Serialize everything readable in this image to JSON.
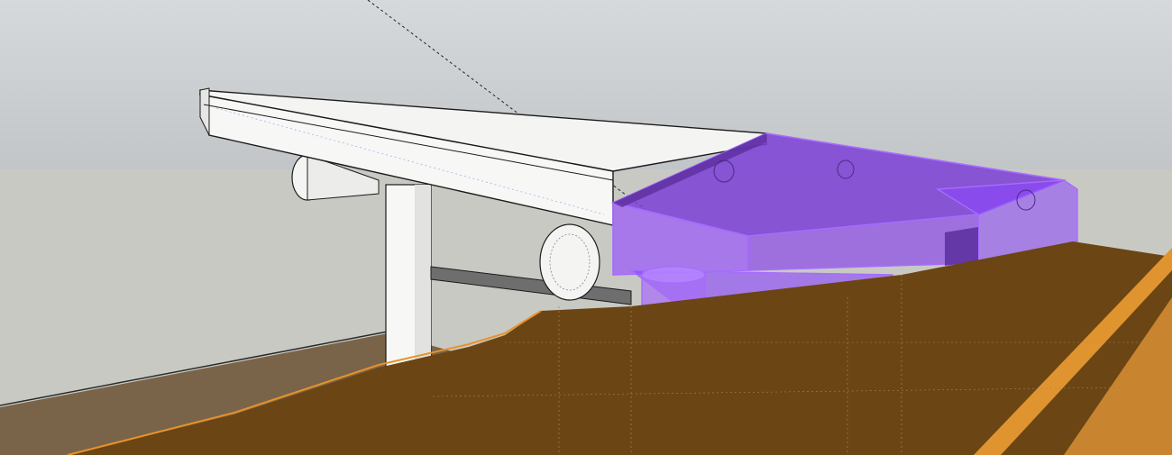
{
  "viewport": {
    "view": "perspective",
    "selection": "solid-purple-building",
    "colors": {
      "sky_top": "#d4d7da",
      "sky_bottom": "#c3c6c9",
      "ground": "#c9c9c4",
      "ground_shadow": "#7a6449",
      "terrain": "#6b4514",
      "terrain_edge": "#e8922a",
      "terrain_highlight": "#c8842f",
      "selection": "#8a44ff",
      "selection_face": "#7b3fd6",
      "selection_dark": "#5b2e9e",
      "selection_edge": "#a86bff",
      "model_white": "#f7f7f6",
      "model_shade": "#d8d8d6",
      "edge": "#1c1c1c"
    }
  }
}
